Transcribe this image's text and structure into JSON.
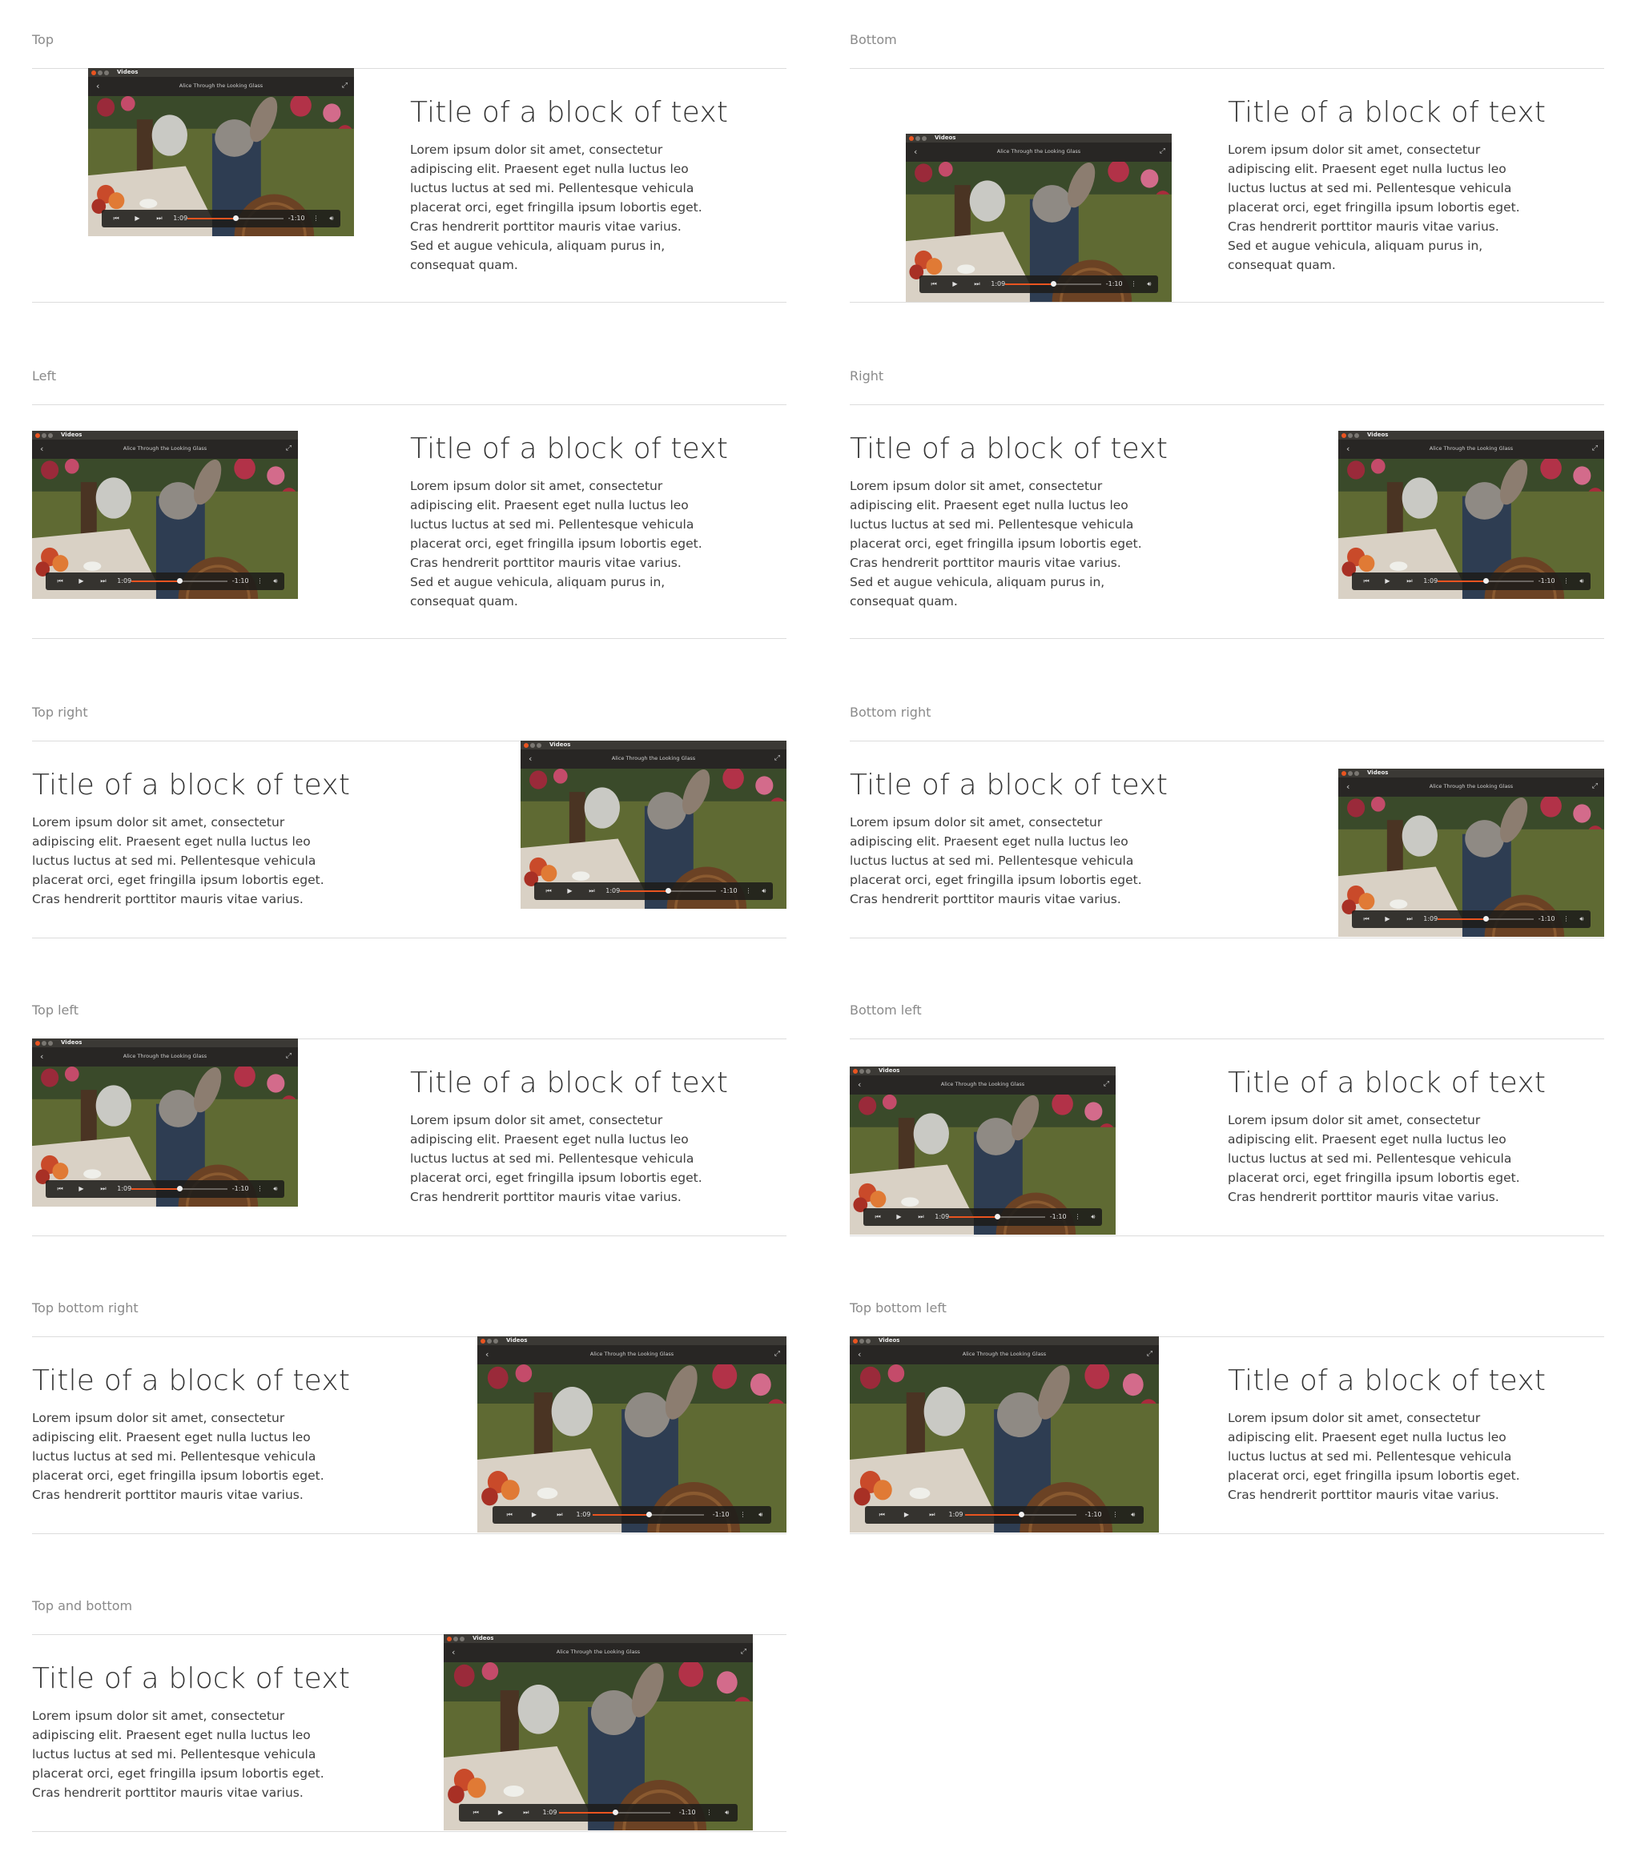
{
  "block": {
    "title": "Title of a block of text",
    "body_long": "Lorem ipsum dolor sit amet, consectetur adipiscing elit. Praesent eget nulla luctus leo luctus luctus at sed mi. Pellentesque vehicula placerat orci, eget fringilla ipsum lobortis eget. Cras hendrerit porttitor mauris vitae varius. Sed et augue vehicula, aliquam purus in, consequat quam.",
    "body_short": "Lorem ipsum dolor sit amet, consectetur adipiscing elit. Praesent eget nulla luctus leo luctus luctus at sed mi. Pellentesque vehicula placerat orci, eget fringilla ipsum lobortis eget. Cras hendrerit porttitor mauris vitae varius."
  },
  "window": {
    "app_title": "Videos",
    "video_title": "Alice Through the Looking Glass",
    "elapsed": "1:09",
    "remaining": "-1:10",
    "progress": 0.5
  },
  "colors": {
    "accent": "#e95420",
    "window_chrome": "#3b3935",
    "label_gray": "#8a8a8a",
    "rule_gray": "#dcdcdc"
  },
  "icons": [
    "close-dot-icon",
    "minimize-dot-icon",
    "maximize-dot-icon",
    "back-icon",
    "fullscreen-icon",
    "skip-back-icon",
    "play-icon",
    "skip-forward-icon",
    "more-icon",
    "volume-icon"
  ],
  "panels": [
    {
      "id": "top",
      "label": "Top"
    },
    {
      "id": "bottom",
      "label": "Bottom"
    },
    {
      "id": "left",
      "label": "Left"
    },
    {
      "id": "right",
      "label": "Right"
    },
    {
      "id": "top-right",
      "label": "Top right"
    },
    {
      "id": "bottom-right",
      "label": "Bottom right"
    },
    {
      "id": "top-left",
      "label": "Top left"
    },
    {
      "id": "bottom-left",
      "label": "Bottom left"
    },
    {
      "id": "top-bottom-right",
      "label": "Top bottom right"
    },
    {
      "id": "top-bottom-left",
      "label": "Top bottom left"
    },
    {
      "id": "top-and-bottom",
      "label": "Top and bottom"
    }
  ]
}
